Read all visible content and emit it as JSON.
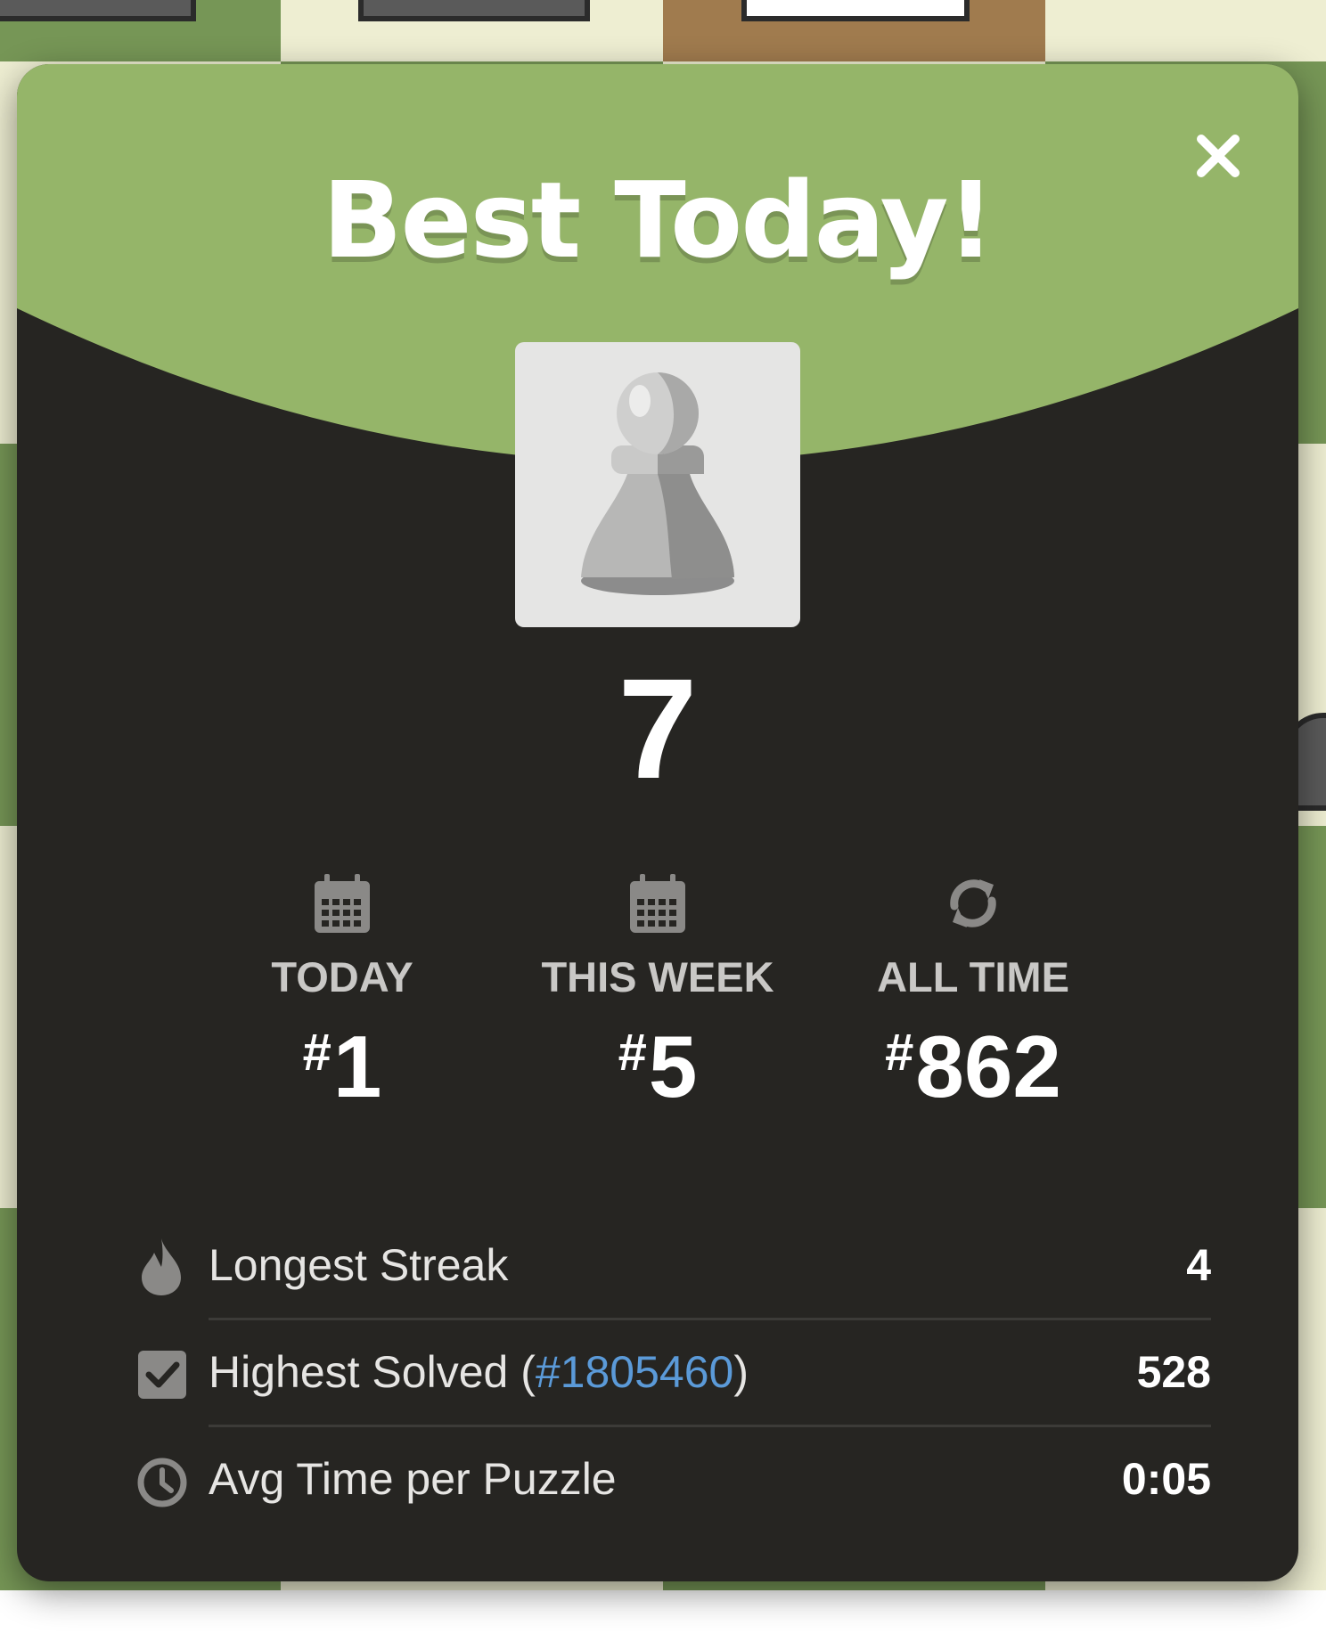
{
  "modal": {
    "title": "Best Today!",
    "score": "7",
    "colors": {
      "header_green": "#95b569",
      "panel_dark": "#262522",
      "link_blue": "#5b9ad8",
      "board_light": "#eeeed2",
      "board_dark": "#769656"
    },
    "ranks": [
      {
        "icon": "calendar-icon",
        "label": "TODAY",
        "hash": "#",
        "value": "1"
      },
      {
        "icon": "calendar-icon",
        "label": "THIS WEEK",
        "hash": "#",
        "value": "5"
      },
      {
        "icon": "refresh-icon",
        "label": "ALL TIME",
        "hash": "#",
        "value": "862"
      }
    ],
    "stats": {
      "longest_streak": {
        "icon": "flame-icon",
        "label": "Longest Streak",
        "value": "4"
      },
      "highest_solved": {
        "icon": "checkbox-icon",
        "label_prefix": "Highest Solved (",
        "link": "#1805460",
        "label_suffix": ")",
        "value": "528"
      },
      "avg_time": {
        "icon": "clock-icon",
        "label": "Avg Time per Puzzle",
        "value": "0:05"
      }
    }
  }
}
